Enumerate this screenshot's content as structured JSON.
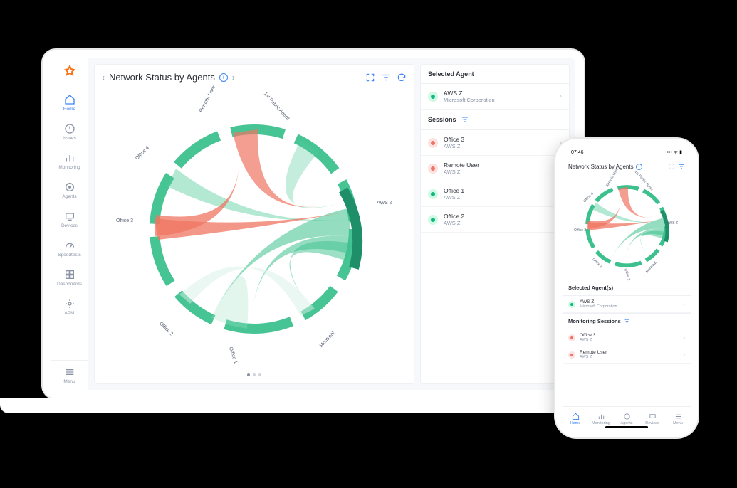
{
  "laptop": {
    "title": "Network Status by Agents",
    "nav": [
      "Home",
      "Issues",
      "Monitoring",
      "Agents",
      "Devices",
      "Speedtests",
      "Dashboards",
      "APM"
    ],
    "nav_bottom": "Menu",
    "nodes": [
      "Remote User",
      "1st Public Agent",
      "AWS Z",
      "Montreal",
      "Office 1",
      "Office 2",
      "Office 3",
      "Office 4"
    ],
    "selectedAgentHeader": "Selected Agent",
    "selectedAgent": {
      "name": "AWS Z",
      "sub": "Microsoft Corporation",
      "status": "green"
    },
    "sessionsHeader": "Sessions",
    "sessions": [
      {
        "name": "Office 3",
        "sub": "AWS Z",
        "status": "red"
      },
      {
        "name": "Remote User",
        "sub": "AWS Z",
        "status": "red"
      },
      {
        "name": "Office 1",
        "sub": "AWS Z",
        "status": "green"
      },
      {
        "name": "Office 2",
        "sub": "AWS Z",
        "status": "green"
      }
    ]
  },
  "phone": {
    "time": "07:46",
    "title": "Network Status by Agents",
    "nodes": [
      "Remote User",
      "1st Public Agent",
      "AWS Z",
      "Montreal",
      "Office 1",
      "Office 2",
      "Office 3",
      "Office 4"
    ],
    "selectedAgentsHeader": "Selected Agent(s)",
    "selectedAgent": {
      "name": "AWS Z",
      "sub": "Microsoft Corporation",
      "status": "green"
    },
    "sessionsHeader": "Monitoring Sessions",
    "sessions": [
      {
        "name": "Office 3",
        "sub": "AWS Z",
        "status": "red"
      },
      {
        "name": "Remote User",
        "sub": "AWS Z",
        "status": "red"
      }
    ],
    "tabs": [
      "Home",
      "Monitoring",
      "Agents",
      "Devices",
      "Menu"
    ]
  },
  "chart_data": {
    "type": "chord",
    "title": "Network Status by Agents",
    "nodes": [
      "Remote User",
      "1st Public Agent",
      "AWS Z",
      "Montreal",
      "Office 1",
      "Office 2",
      "Office 3",
      "Office 4"
    ],
    "links": [
      {
        "source": "AWS Z",
        "target": "Office 1",
        "status": "ok",
        "weight": 3
      },
      {
        "source": "AWS Z",
        "target": "Office 2",
        "status": "ok",
        "weight": 3
      },
      {
        "source": "AWS Z",
        "target": "Office 3",
        "status": "bad",
        "weight": 3
      },
      {
        "source": "AWS Z",
        "target": "Office 4",
        "status": "ok",
        "weight": 2
      },
      {
        "source": "AWS Z",
        "target": "Remote User",
        "status": "bad",
        "weight": 2
      },
      {
        "source": "AWS Z",
        "target": "1st Public Agent",
        "status": "ok",
        "weight": 1
      },
      {
        "source": "AWS Z",
        "target": "Montreal",
        "status": "ok",
        "weight": 2
      },
      {
        "source": "Office 3",
        "target": "Remote User",
        "status": "bad",
        "weight": 1
      },
      {
        "source": "Office 1",
        "target": "Office 2",
        "status": "ok",
        "weight": 1
      },
      {
        "source": "Office 1",
        "target": "Montreal",
        "status": "ok",
        "weight": 1
      }
    ],
    "colors": {
      "ok": "#3cc18e",
      "bad": "#ef7562",
      "arc": "#3cc18e"
    }
  }
}
